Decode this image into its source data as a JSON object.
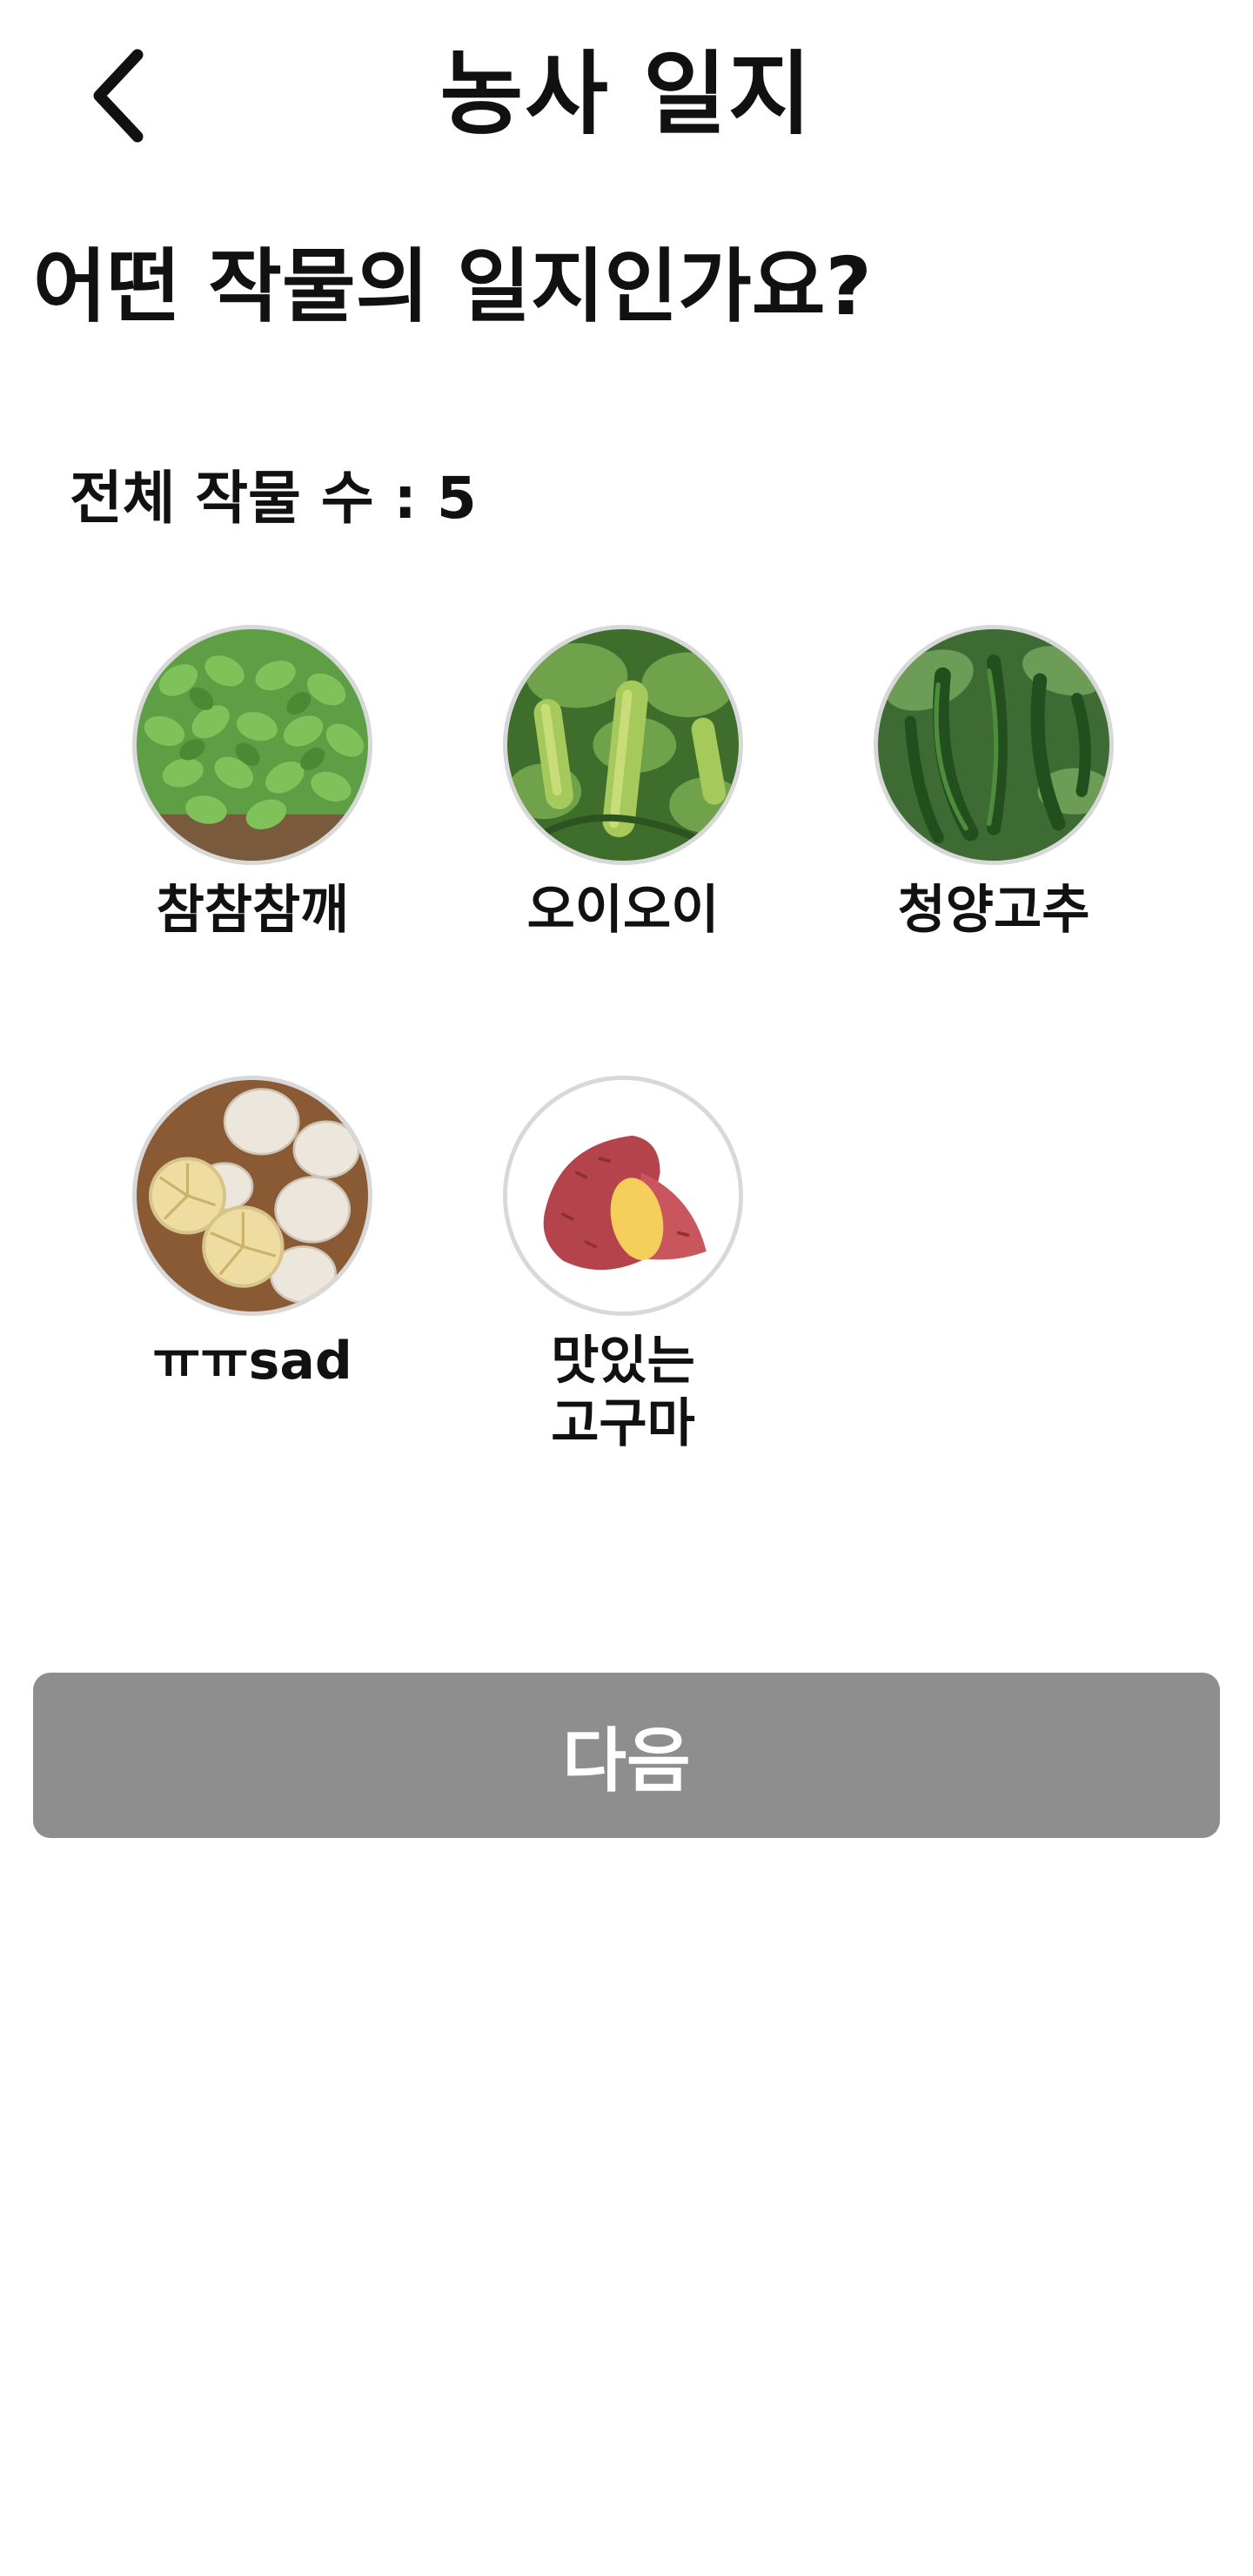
{
  "header": {
    "title": "농사 일지",
    "back_icon": "chevron-left-icon"
  },
  "question": "어떤 작물의 일지인가요?",
  "count": {
    "text": "전체 작물 수 : 5"
  },
  "crops": [
    {
      "label": "참참참깨",
      "image": "sesame-seedlings"
    },
    {
      "label": "오이오이",
      "image": "cucumber"
    },
    {
      "label": "청양고추",
      "image": "green-chili-pepper"
    },
    {
      "label": "ㅠㅠsad",
      "image": "garlic"
    },
    {
      "label": "맛있는\n고구마",
      "image": "sweet-potato"
    }
  ],
  "next_button": {
    "label": "다음",
    "color": "#8e8e8e"
  }
}
